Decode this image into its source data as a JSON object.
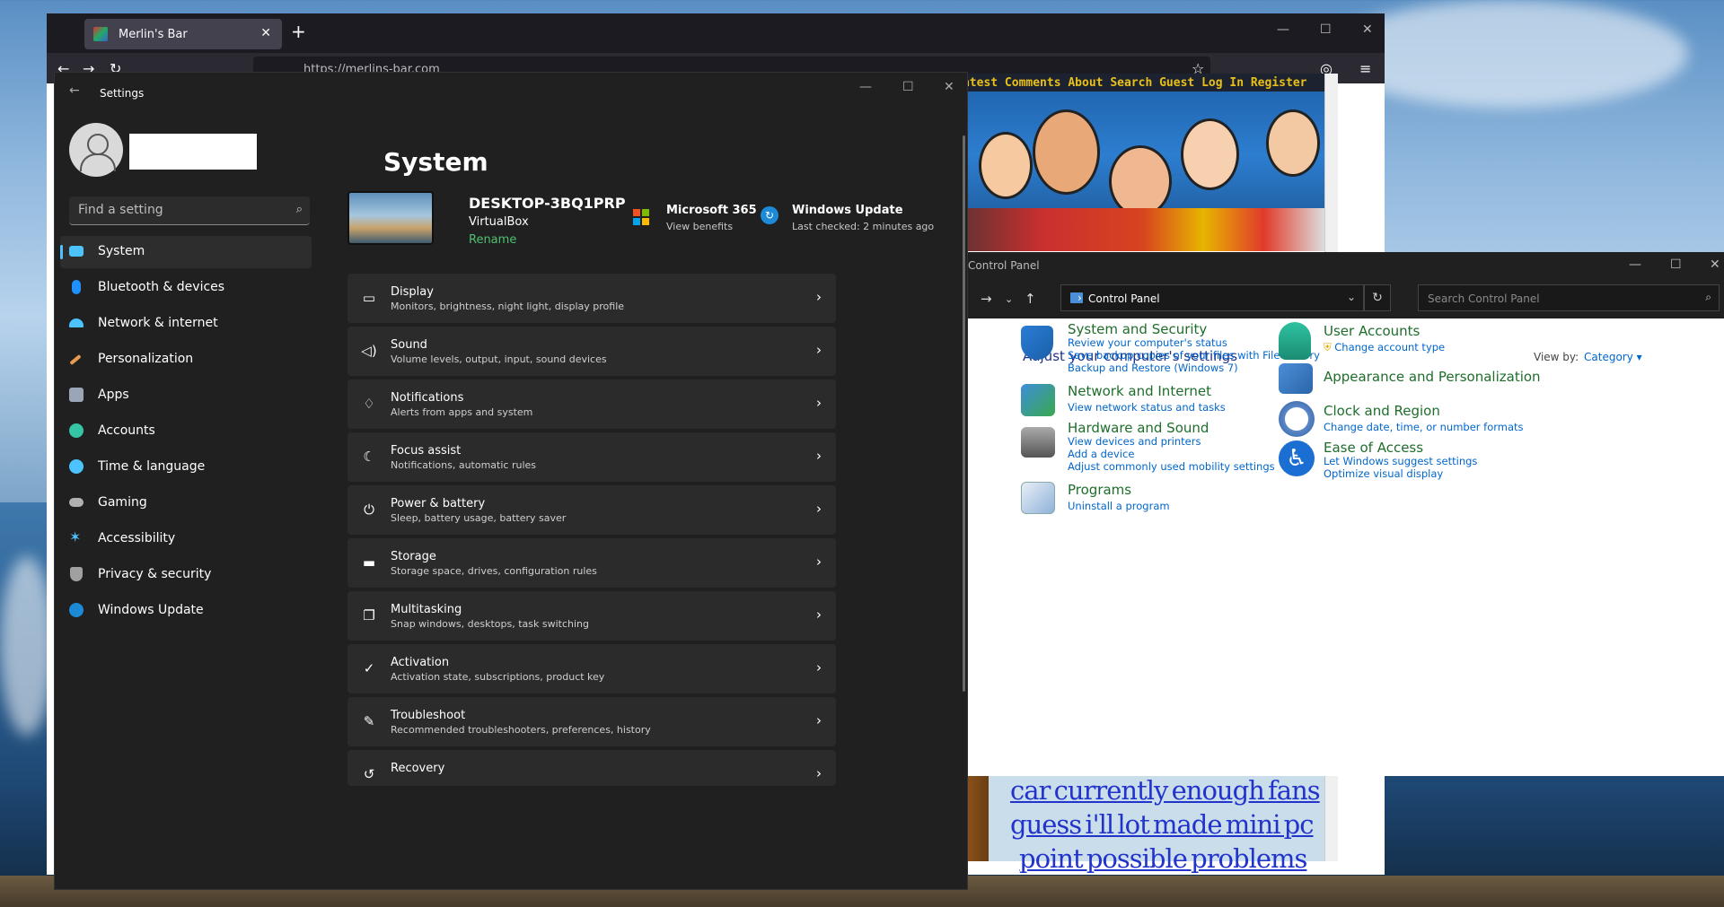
{
  "browser": {
    "tab_title": "Merlin's Bar",
    "url": "https://merlins-bar.com",
    "site_nav": "Home Latest Comments About Search Guest Log In Register",
    "lower_words": [
      "car currently enough fans",
      "guess i'll lot made mini pc",
      "point possible problems"
    ]
  },
  "settings": {
    "title": "Settings",
    "search_placeholder": "Find a setting",
    "page_title": "System",
    "device": {
      "name": "DESKTOP-3BQ1PRP",
      "sub": "VirtualBox",
      "rename": "Rename"
    },
    "ms365": {
      "title": "Microsoft 365",
      "sub": "View benefits"
    },
    "update": {
      "title": "Windows Update",
      "sub": "Last checked: 2 minutes ago"
    },
    "nav": [
      {
        "label": "System",
        "icon": "monitor-icon",
        "color": "#4cc2ff"
      },
      {
        "label": "Bluetooth & devices",
        "icon": "bluetooth-icon",
        "color": "#1e90ff"
      },
      {
        "label": "Network & internet",
        "icon": "wifi-icon",
        "color": "#4cc2ff"
      },
      {
        "label": "Personalization",
        "icon": "brush-icon",
        "color": "#e89a4d"
      },
      {
        "label": "Apps",
        "icon": "apps-icon",
        "color": "#9aa6b8"
      },
      {
        "label": "Accounts",
        "icon": "person-icon",
        "color": "#36c5a4"
      },
      {
        "label": "Time & language",
        "icon": "globe-clock-icon",
        "color": "#4cc2ff"
      },
      {
        "label": "Gaming",
        "icon": "gamepad-icon",
        "color": "#b0b0b0"
      },
      {
        "label": "Accessibility",
        "icon": "accessibility-icon",
        "color": "#4cc2ff"
      },
      {
        "label": "Privacy & security",
        "icon": "shield-icon",
        "color": "#a0a0a0"
      },
      {
        "label": "Windows Update",
        "icon": "update-icon",
        "color": "#1c8ad6"
      }
    ],
    "cards": [
      {
        "title": "Display",
        "sub": "Monitors, brightness, night light, display profile",
        "icon": "display-icon",
        "glyph": "▭"
      },
      {
        "title": "Sound",
        "sub": "Volume levels, output, input, sound devices",
        "icon": "speaker-icon",
        "glyph": "🔈"
      },
      {
        "title": "Notifications",
        "sub": "Alerts from apps and system",
        "icon": "bell-icon",
        "glyph": "🔔"
      },
      {
        "title": "Focus assist",
        "sub": "Notifications, automatic rules",
        "icon": "moon-icon",
        "glyph": "☾"
      },
      {
        "title": "Power & battery",
        "sub": "Sleep, battery usage, battery saver",
        "icon": "power-icon",
        "glyph": "⏻"
      },
      {
        "title": "Storage",
        "sub": "Storage space, drives, configuration rules",
        "icon": "drive-icon",
        "glyph": "▬"
      },
      {
        "title": "Multitasking",
        "sub": "Snap windows, desktops, task switching",
        "icon": "windows-icon",
        "glyph": "❐"
      },
      {
        "title": "Activation",
        "sub": "Activation state, subscriptions, product key",
        "icon": "check-circle-icon",
        "glyph": "✓"
      },
      {
        "title": "Troubleshoot",
        "sub": "Recommended troubleshooters, preferences, history",
        "icon": "wrench-icon",
        "glyph": "🔧"
      },
      {
        "title": "Recovery",
        "sub": "",
        "icon": "recovery-icon",
        "glyph": "↺"
      }
    ]
  },
  "control_panel": {
    "title": "Control Panel",
    "path": "Control Panel",
    "search_placeholder": "Search Control Panel",
    "heading": "Adjust your computer's settings",
    "view_by": "View by:",
    "view_value": "Category",
    "left": [
      {
        "title": "System and Security",
        "icon": "shield-security-icon",
        "links": [
          "Review your computer's status",
          "Save backup copies of your files with File History",
          "Backup and Restore (Windows 7)"
        ]
      },
      {
        "title": "Network and Internet",
        "icon": "network-globe-icon",
        "links": [
          "View network status and tasks"
        ]
      },
      {
        "title": "Hardware and Sound",
        "icon": "printer-icon",
        "links": [
          "View devices and printers",
          "Add a device",
          "Adjust commonly used mobility settings"
        ]
      },
      {
        "title": "Programs",
        "icon": "programs-icon",
        "links": [
          "Uninstall a program"
        ]
      }
    ],
    "right": [
      {
        "title": "User Accounts",
        "icon": "users-icon",
        "links": [
          "Change account type"
        ]
      },
      {
        "title": "Appearance and Personalization",
        "icon": "appearance-icon",
        "links": []
      },
      {
        "title": "Clock and Region",
        "icon": "clock-icon",
        "links": [
          "Change date, time, or number formats"
        ]
      },
      {
        "title": "Ease of Access",
        "icon": "ease-access-icon",
        "links": [
          "Let Windows suggest settings",
          "Optimize visual display"
        ]
      }
    ]
  }
}
